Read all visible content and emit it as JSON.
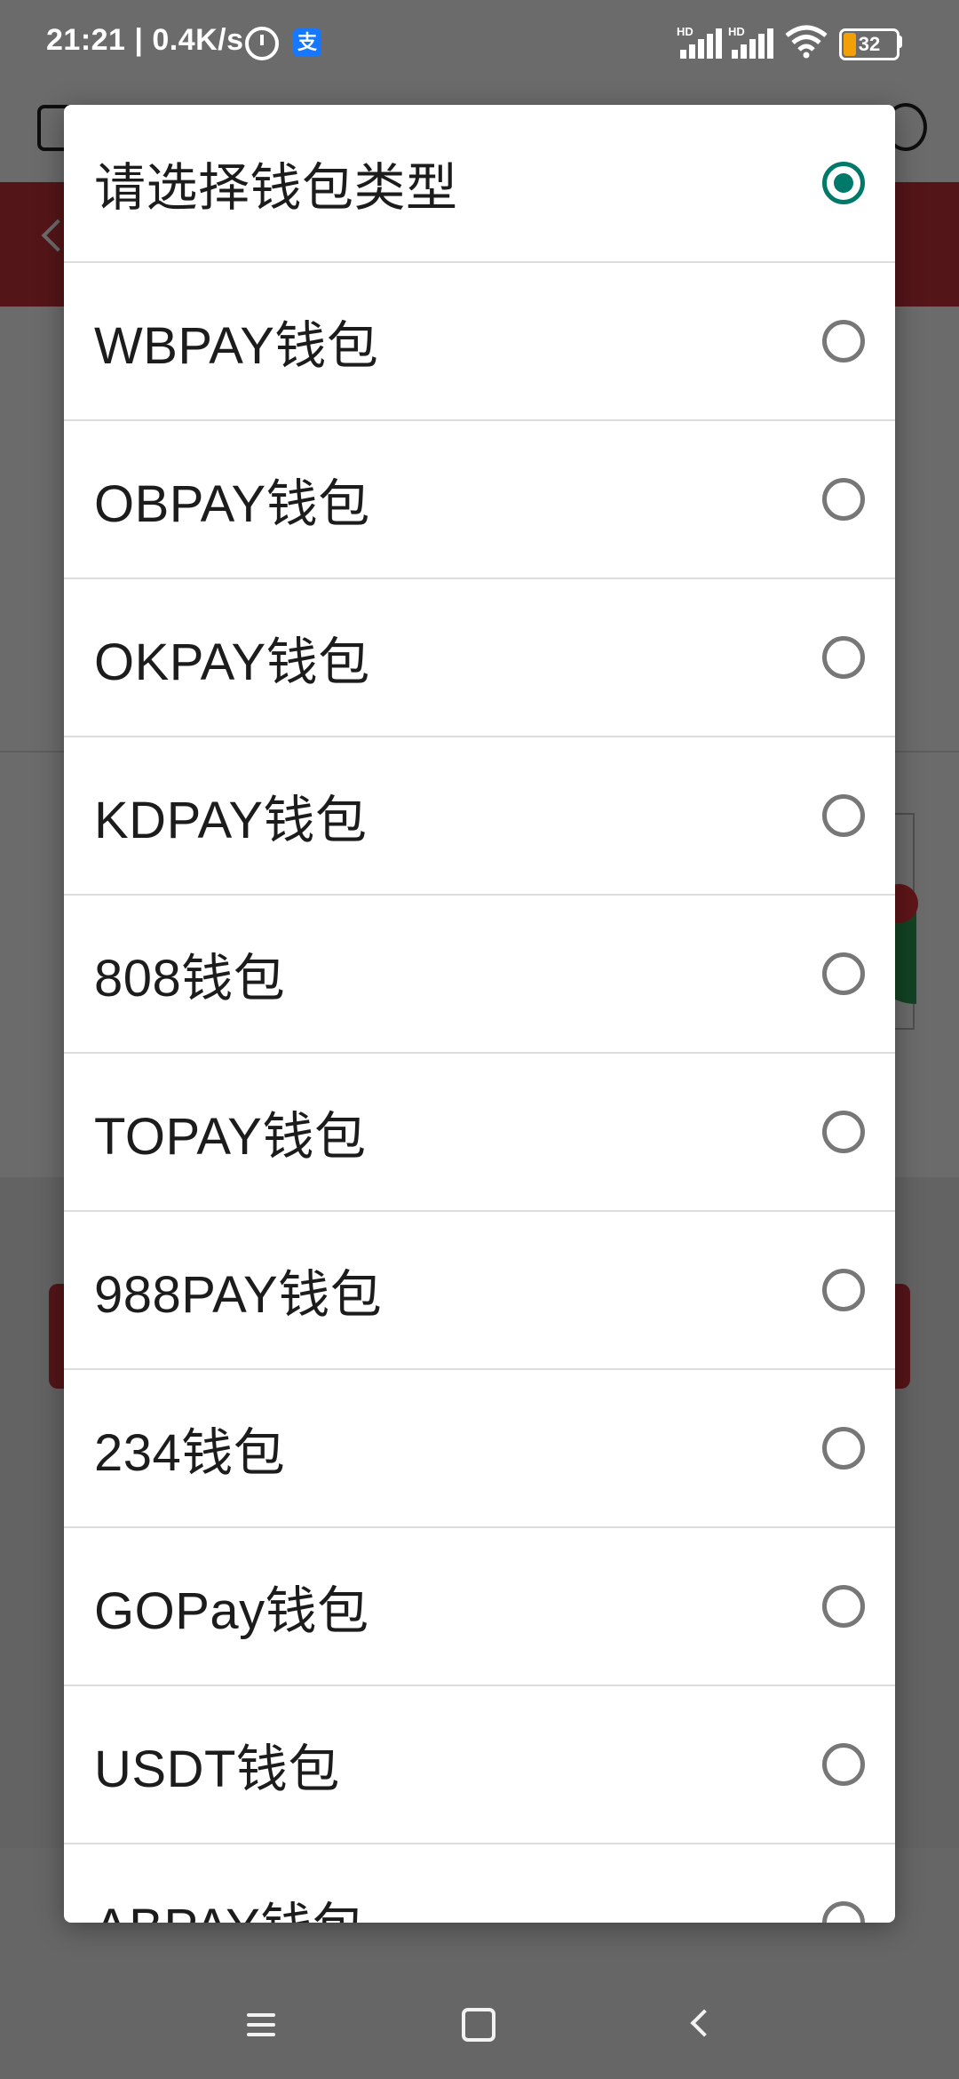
{
  "status_bar": {
    "time": "21:21 | 0.4K/s",
    "alipay_glyph": "支",
    "network_label_1": "HD",
    "network_label_2": "HD",
    "battery_level": "32",
    "icons": [
      "alarm-icon",
      "alipay-icon",
      "signal-icon",
      "wifi-icon",
      "battery-icon"
    ]
  },
  "dialog": {
    "options": [
      {
        "label": "请选择钱包类型",
        "checked": true
      },
      {
        "label": "WBPAY钱包",
        "checked": false
      },
      {
        "label": "OBPAY钱包",
        "checked": false
      },
      {
        "label": "OKPAY钱包",
        "checked": false
      },
      {
        "label": "KDPAY钱包",
        "checked": false
      },
      {
        "label": "808钱包",
        "checked": false
      },
      {
        "label": "TOPAY钱包",
        "checked": false
      },
      {
        "label": "988PAY钱包",
        "checked": false
      },
      {
        "label": "234钱包",
        "checked": false
      },
      {
        "label": "GOPay钱包",
        "checked": false
      },
      {
        "label": "USDT钱包",
        "checked": false
      },
      {
        "label": "ABPAY钱包",
        "checked": false
      }
    ]
  },
  "nav_bar": {
    "icons": [
      "menu-icon",
      "home-icon",
      "back-icon"
    ]
  },
  "colors": {
    "accent": "#00796b",
    "scrim": "#000000",
    "brand_red": "#c9323a"
  }
}
